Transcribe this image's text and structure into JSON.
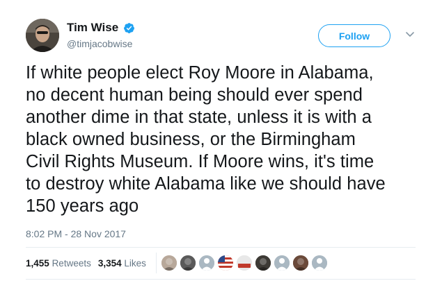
{
  "tweet": {
    "author": {
      "name": "Tim Wise",
      "handle": "@timjacobwise",
      "verified": true
    },
    "follow_label": "Follow",
    "text": "If white people elect Roy Moore in Alabama, no decent human being should ever spend another dime in that state, unless it is with a black owned business, or the Birmingham Civil Rights Museum. If Moore wins, it's time to destroy white Alabama like we should have 150 years ago",
    "text_lines": [
      "If white people elect Roy Moore in Alabama,",
      "no decent human being should ever spend",
      "another dime in that state, unless it is with a",
      "black owned business, or the Birmingham",
      "Civil Rights Museum. If Moore wins, it's time",
      "to destroy white Alabama like we should have",
      "150 years ago"
    ],
    "timestamp": "8:02 PM - 28 Nov 2017",
    "stats": {
      "retweets_count": "1,455",
      "retweets_label": "Retweets",
      "likes_count": "3,354",
      "likes_label": "Likes"
    },
    "liker_avatars": [
      {
        "icon": "photo-avatar",
        "color": "#b8a89a"
      },
      {
        "icon": "photo-avatar",
        "color": "#5a5a5a"
      },
      {
        "icon": "default-egg-avatar",
        "color": "#aab8c2"
      },
      {
        "icon": "flag-avatar",
        "color": "#c0392b"
      },
      {
        "icon": "resist-badge-avatar",
        "color": "#d9d9d9"
      },
      {
        "icon": "photo-avatar",
        "color": "#3d3a35"
      },
      {
        "icon": "default-egg-avatar",
        "color": "#aab8c2"
      },
      {
        "icon": "photo-avatar",
        "color": "#6b4a3a"
      },
      {
        "icon": "default-egg-avatar",
        "color": "#aab8c2"
      }
    ],
    "colors": {
      "accent": "#1da1f2",
      "text": "#14171a",
      "secondary": "#657786",
      "divider": "#e6ecf0"
    }
  }
}
